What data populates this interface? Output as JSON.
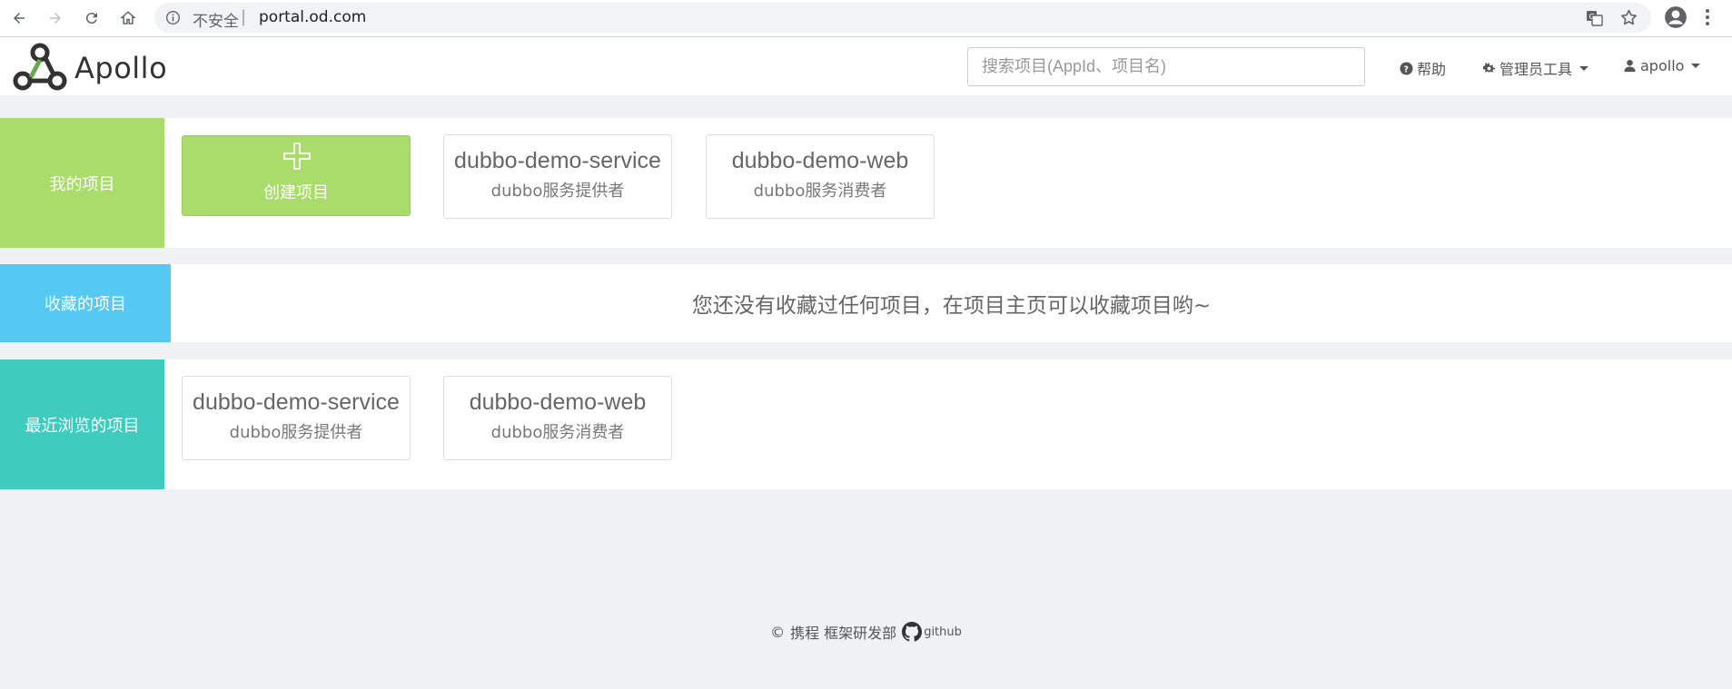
{
  "browser": {
    "security_label": "不安全",
    "separator": "|",
    "url": "portal.od.com",
    "icons": [
      "back-icon",
      "forward-icon",
      "reload-icon",
      "home-icon",
      "info-icon",
      "translate-icon",
      "star-icon",
      "account-icon",
      "menu-icon"
    ]
  },
  "header": {
    "brand": "Apollo",
    "search_placeholder": "搜索项目(AppId、项目名)",
    "help_label": "帮助",
    "admin_label": "管理员工具",
    "user_label": "apollo"
  },
  "my_projects": {
    "label": "我的项目",
    "label_color": "#a9dc6a",
    "create_label": "创建项目",
    "items": [
      {
        "name": "dubbo-demo-service",
        "desc": "dubbo服务提供者"
      },
      {
        "name": "dubbo-demo-web",
        "desc": "dubbo服务消费者"
      }
    ]
  },
  "favorites": {
    "label": "收藏的项目",
    "label_color": "#56c9f3",
    "empty_message": "您还没有收藏过任何项目，在项目主页可以收藏项目哟~"
  },
  "recent": {
    "label": "最近浏览的项目",
    "label_color": "#3fcbbd",
    "items": [
      {
        "name": "dubbo-demo-service",
        "desc": "dubbo服务提供者"
      },
      {
        "name": "dubbo-demo-web",
        "desc": "dubbo服务消费者"
      }
    ]
  },
  "footer": {
    "copyright_symbol": "©",
    "company": "携程 框架研发部",
    "github_label": "github"
  }
}
